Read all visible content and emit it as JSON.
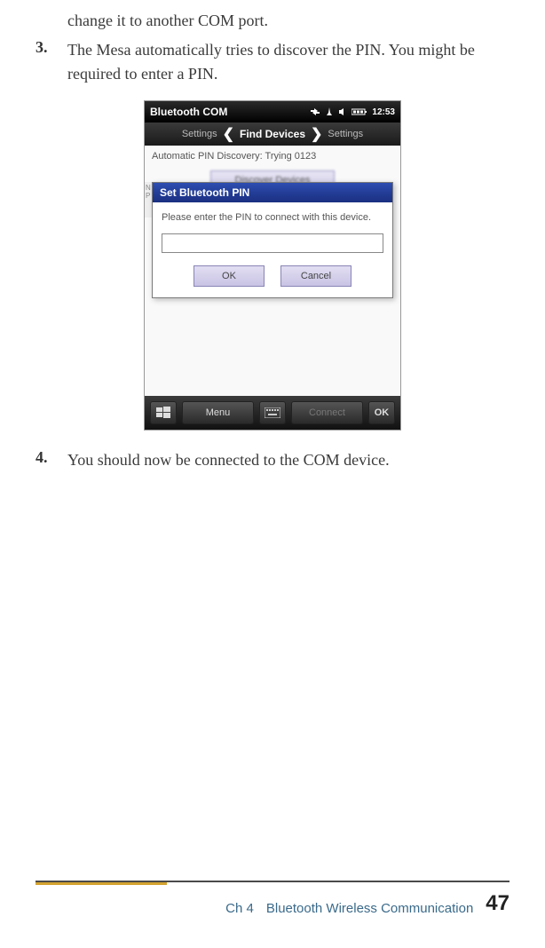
{
  "body": {
    "prevFragment": "change it to another COM port.",
    "item3Num": "3.",
    "item3Text": "The Mesa automatically tries to discover the PIN. You might be required to enter a PIN.",
    "item4Num": "4.",
    "item4Text": "You should now be connected to the COM device."
  },
  "screenshot": {
    "titlebar": {
      "title": "Bluetooth COM",
      "clock": "12:53"
    },
    "subbar": {
      "left": "Settings",
      "center": "Find Devices",
      "right": "Settings"
    },
    "discoveryText": "Automatic PIN Discovery: Trying 0123",
    "bgButton": "Discover Devices",
    "bgTabN": "N",
    "bgTabP": "P",
    "dialog": {
      "title": "Set Bluetooth PIN",
      "message": "Please enter the PIN to connect with this device.",
      "ok": "OK",
      "cancel": "Cancel"
    },
    "bottombar": {
      "menu": "Menu",
      "connect": "Connect",
      "ok": "OK"
    }
  },
  "footer": {
    "chapter": "Ch 4",
    "title": "Bluetooth Wireless Communication",
    "page": "47"
  }
}
